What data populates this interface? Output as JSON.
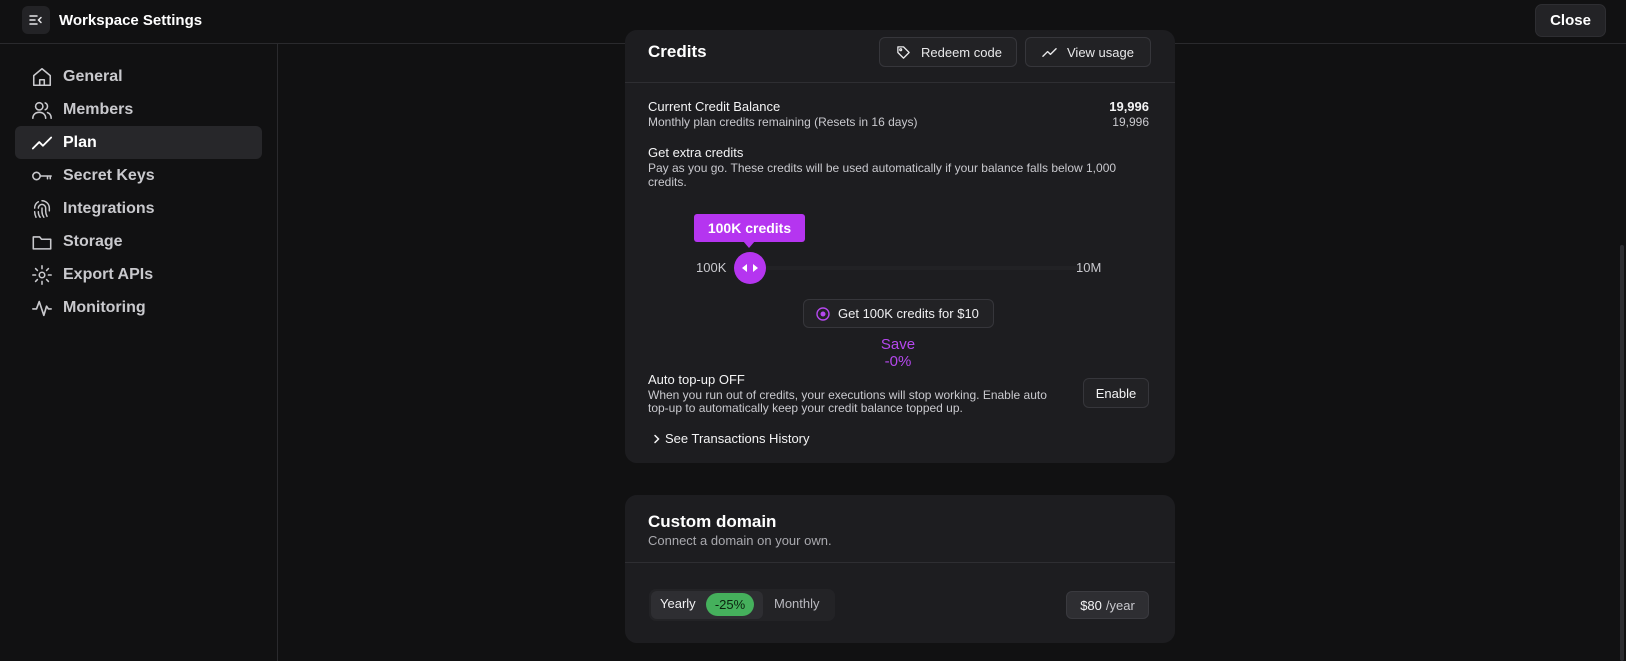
{
  "header": {
    "title": "Workspace Settings",
    "close_label": "Close"
  },
  "sidebar": {
    "items": [
      {
        "label": "General",
        "icon": "home-icon"
      },
      {
        "label": "Members",
        "icon": "users-icon"
      },
      {
        "label": "Plan",
        "icon": "trend-icon",
        "active": true
      },
      {
        "label": "Secret Keys",
        "icon": "key-icon"
      },
      {
        "label": "Integrations",
        "icon": "fingerprint-icon"
      },
      {
        "label": "Storage",
        "icon": "folder-icon"
      },
      {
        "label": "Export APIs",
        "icon": "export-api-icon"
      },
      {
        "label": "Monitoring",
        "icon": "pulse-icon"
      }
    ]
  },
  "credits": {
    "title": "Credits",
    "redeem_label": "Redeem code",
    "usage_label": "View usage",
    "balance_label": "Current Credit Balance",
    "balance_value": "19,996",
    "monthly_label": "Monthly plan credits remaining (Resets in 16 days)",
    "monthly_value": "19,996",
    "extra_title": "Get extra credits",
    "extra_desc_line1": "Pay as you go. These credits will be used automatically if your balance falls below 1,000",
    "extra_desc_line2": "credits.",
    "slider": {
      "tooltip": "100K credits",
      "min_label": "100K",
      "max_label": "10M",
      "position": 0
    },
    "buy_label": "Get 100K credits for $10",
    "save_label": "Save -0%",
    "auto_topup_title": "Auto top-up OFF",
    "auto_topup_desc_line1": "When you run out of credits, your executions will stop working. Enable auto",
    "auto_topup_desc_line2": "top-up to automatically keep your credit balance topped up.",
    "enable_label": "Enable",
    "history_label": "See Transactions History"
  },
  "domain": {
    "title": "Custom domain",
    "subtitle": "Connect a domain on your own.",
    "yearly_label": "Yearly",
    "discount": "-25%",
    "monthly_label": "Monthly",
    "price": "$80",
    "period": "/year"
  },
  "colors": {
    "accent": "#b535f0",
    "discount_green": "#45b05c",
    "background": "#111112",
    "card": "#1d1d20"
  }
}
